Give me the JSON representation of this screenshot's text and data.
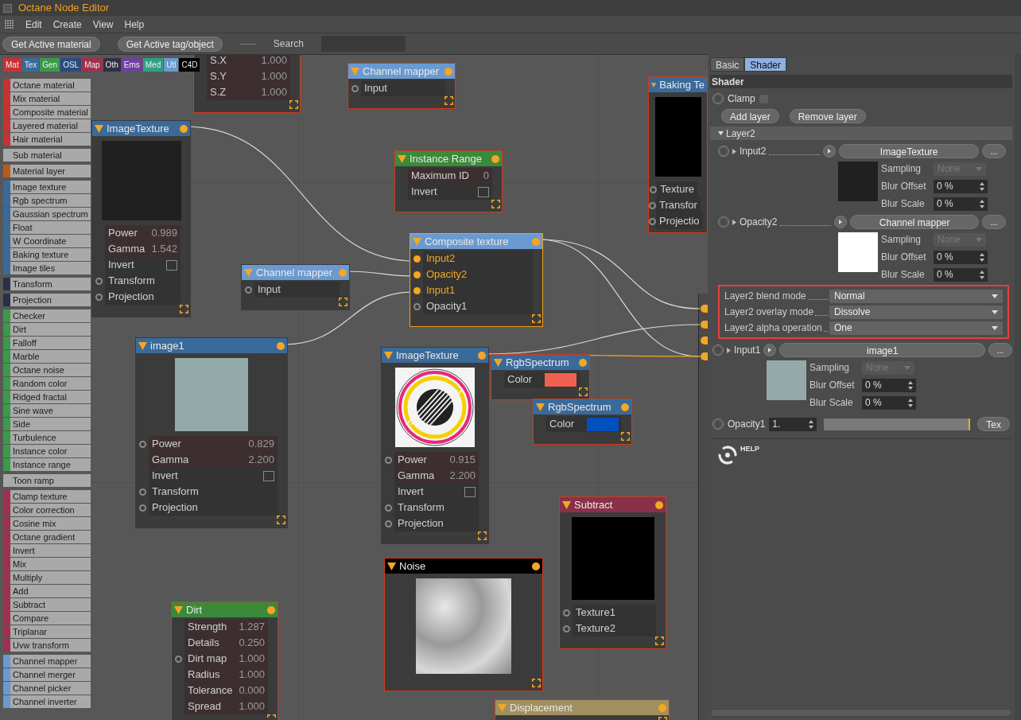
{
  "window": {
    "title": "Octane Node Editor"
  },
  "menu": [
    "Edit",
    "Create",
    "View",
    "Help"
  ],
  "toolbar": {
    "buttons": [
      "Get Active material",
      "Get Active tag/object"
    ],
    "search_label": "Search"
  },
  "palette": {
    "categories": [
      {
        "label": "Mat",
        "color": "#c83232"
      },
      {
        "label": "Tex",
        "color": "#3a6a9a"
      },
      {
        "label": "Gen",
        "color": "#3a9a4a"
      },
      {
        "label": "OSL",
        "color": "#2a4a80"
      },
      {
        "label": "Map",
        "color": "#a03050"
      },
      {
        "label": "Oth",
        "color": "#303040"
      },
      {
        "label": "Ems",
        "color": "#7040a0"
      },
      {
        "label": "Med",
        "color": "#30a080"
      },
      {
        "label": "Utl",
        "color": "#6a9ad0"
      },
      {
        "label": "C4D",
        "color": "#000000"
      }
    ],
    "groups": [
      {
        "color": "#c83232",
        "items": [
          "Octane material",
          "Mix material",
          "Composite material",
          "Layered material",
          "Hair material"
        ]
      },
      {
        "items": [
          "Sub material"
        ]
      },
      {
        "color": "#b85a20",
        "items": [
          "Material layer"
        ]
      },
      {
        "color": "#3a6a9a",
        "items": [
          "Image texture",
          "Rgb spectrum",
          "Gaussian spectrum",
          "Float",
          "W Coordinate",
          "Baking texture",
          "Image tiles"
        ]
      },
      {
        "color": "#2a3048",
        "items": [
          "Transform"
        ]
      },
      {
        "color": "#2a3048",
        "items": [
          "Projection"
        ]
      },
      {
        "color": "#3a9a4a",
        "items": [
          "Checker",
          "Dirt",
          "Falloff",
          "Marble",
          "Octane noise",
          "Random color",
          "Ridged fractal",
          "Sine wave",
          "Side",
          "Turbulence",
          "Instance color",
          "Instance range"
        ]
      },
      {
        "items": [
          "Toon ramp"
        ]
      },
      {
        "color": "#a03050",
        "items": [
          "Clamp texture",
          "Color correction",
          "Cosine mix",
          "Octane gradient",
          "Invert",
          "Mix",
          "Multiply",
          "Add",
          "Subtract",
          "Compare",
          "Triplanar",
          "Uvw transform"
        ]
      },
      {
        "color": "#6a9ad0",
        "items": [
          "Channel mapper",
          "Channel merger",
          "Channel picker",
          "Channel inverter"
        ]
      }
    ]
  },
  "nodes": [
    {
      "selected": true,
      "active": false,
      "rows": [
        {
          "kind": "value",
          "label": "S.X",
          "value": "1.000"
        },
        {
          "kind": "value",
          "label": "S.Y",
          "value": "1.000"
        },
        {
          "kind": "value",
          "label": "S.Z",
          "value": "1.000"
        }
      ]
    },
    {
      "title": "Channel mapper",
      "color": "#6a9ad0",
      "selected": true,
      "active": false,
      "rows": [
        {
          "kind": "port",
          "label": "Input",
          "connected": false
        }
      ]
    },
    {
      "title": "ImageTexture",
      "color": "#3a6a9a",
      "selected": false,
      "active": false,
      "preview": {
        "kind": "photo"
      },
      "rows": [
        {
          "kind": "value",
          "label": "Power",
          "value": "0.989"
        },
        {
          "kind": "value",
          "label": "Gamma",
          "value": "1.542"
        },
        {
          "kind": "check",
          "label": "Invert",
          "checked": false
        },
        {
          "kind": "port",
          "label": "Transform",
          "connected": false
        },
        {
          "kind": "port",
          "label": "Projection",
          "connected": false
        }
      ]
    },
    {
      "title": "Instance Range",
      "color": "#3a8a3a",
      "selected": true,
      "active": false,
      "rows": [
        {
          "kind": "value",
          "label": "Maximum ID",
          "value": "0"
        },
        {
          "kind": "check",
          "label": "Invert",
          "checked": false
        }
      ]
    },
    {
      "title": "Composite texture",
      "color": "#6a9ad0",
      "selected": false,
      "active": true,
      "rows": [
        {
          "kind": "port",
          "label": "Input2",
          "connected": true
        },
        {
          "kind": "port",
          "label": "Opacity2",
          "connected": true
        },
        {
          "kind": "port",
          "label": "Input1",
          "connected": true
        },
        {
          "kind": "port",
          "label": "Opacity1",
          "connected": false
        }
      ]
    },
    {
      "title": "Channel mapper",
      "color": "#6a9ad0",
      "selected": false,
      "active": false,
      "rows": [
        {
          "kind": "port",
          "label": "Input",
          "connected": false
        }
      ]
    },
    {
      "title": "image1",
      "color": "#3a6a9a",
      "selected": false,
      "active": false,
      "preview": {
        "kind": "pattern"
      },
      "rows": [
        {
          "kind": "port",
          "label": "Power",
          "value": "0.829",
          "connected": false
        },
        {
          "kind": "value",
          "label": "Gamma",
          "value": "2.200"
        },
        {
          "kind": "check",
          "label": "Invert",
          "checked": false
        },
        {
          "kind": "port",
          "label": "Transform",
          "connected": false
        },
        {
          "kind": "port",
          "label": "Projection",
          "connected": false
        }
      ]
    },
    {
      "title": "ImageTexture",
      "color": "#3a6a9a",
      "selected": false,
      "active": false,
      "preview": {
        "kind": "rings"
      },
      "rows": [
        {
          "kind": "port",
          "label": "Power",
          "value": "0.915",
          "connected": false
        },
        {
          "kind": "value",
          "label": "Gamma",
          "value": "2.200"
        },
        {
          "kind": "check",
          "label": "Invert",
          "checked": false
        },
        {
          "kind": "port",
          "label": "Transform",
          "connected": false
        },
        {
          "kind": "port",
          "label": "Projection",
          "connected": false
        }
      ]
    },
    {
      "title": "RgbSpectrum",
      "color": "#3a6a9a",
      "selected": true,
      "active": false,
      "rows": [
        {
          "kind": "color",
          "label": "Color",
          "color": "#f06050"
        }
      ]
    },
    {
      "title": "RgbSpectrum",
      "color": "#3a6a9a",
      "selected": true,
      "active": false,
      "rows": [
        {
          "kind": "color",
          "label": "Color",
          "color": "#0050c0"
        }
      ]
    },
    {
      "title": "Baking Te",
      "color": "#3a6a9a",
      "selected": true,
      "active": false,
      "preview": {
        "kind": "blank"
      },
      "rows": [
        {
          "kind": "port",
          "label": "Texture",
          "connected": false
        },
        {
          "kind": "port",
          "label": "Transfor",
          "connected": false
        },
        {
          "kind": "port",
          "label": "Projectio",
          "connected": false
        }
      ]
    },
    {
      "title": "Noise",
      "color": "#000000",
      "selected": true,
      "active": false,
      "preview": {
        "kind": "noise"
      }
    },
    {
      "title": "Subtract",
      "color": "#8a3048",
      "selected": true,
      "active": false,
      "preview": {
        "kind": "blank"
      },
      "rows": [
        {
          "kind": "port",
          "label": "Texture1",
          "connected": false
        },
        {
          "kind": "port",
          "label": "Texture2",
          "connected": false
        }
      ]
    },
    {
      "title": "Dirt",
      "color": "#3a8a3a",
      "selected": true,
      "active": false,
      "rows": [
        {
          "kind": "value",
          "label": "Strength",
          "value": "1.287"
        },
        {
          "kind": "value",
          "label": "Details",
          "value": "0.250"
        },
        {
          "kind": "port",
          "label": "Dirt map",
          "value": "1.000",
          "connected": false
        },
        {
          "kind": "value",
          "label": "Radius",
          "value": "1.000"
        },
        {
          "kind": "value",
          "label": "Tolerance",
          "value": "0.000"
        },
        {
          "kind": "value",
          "label": "Spread",
          "value": "1.000"
        }
      ]
    },
    {
      "title": "Displacement",
      "color": "#a09060",
      "selected": true,
      "active": false
    }
  ],
  "inspector": {
    "tabs": [
      {
        "label": "Basic",
        "selected": false
      },
      {
        "label": "Shader",
        "selected": true
      }
    ],
    "section": "Shader",
    "clamp": {
      "label": "Clamp",
      "checked": false
    },
    "buttons": [
      "Add layer",
      "Remove layer"
    ],
    "layer": {
      "label": "Layer2",
      "expanded": true,
      "inputs": [
        {
          "label": "Input2",
          "target": "ImageTexture",
          "more": "...",
          "preview": {
            "kind": "photo"
          },
          "params": [
            {
              "kind": "dropdown",
              "label": "Sampling",
              "value": "None",
              "disabled": true
            },
            {
              "kind": "spinner",
              "label": "Blur Offset",
              "value": "0 %"
            },
            {
              "kind": "spinner",
              "label": "Blur Scale",
              "value": "0 %"
            }
          ]
        },
        {
          "label": "Opacity2",
          "target": "Channel mapper",
          "more": "...",
          "preview": {
            "kind": "mask"
          },
          "params": [
            {
              "kind": "dropdown",
              "label": "Sampling",
              "value": "None",
              "disabled": true
            },
            {
              "kind": "spinner",
              "label": "Blur Offset",
              "value": "0 %"
            },
            {
              "kind": "spinner",
              "label": "Blur Scale",
              "value": "0 %"
            }
          ]
        }
      ],
      "modes": [
        {
          "label": "Layer2 blend mode",
          "value": "Normal"
        },
        {
          "label": "Layer2 overlay mode",
          "value": "Dissolve"
        },
        {
          "label": "Layer2 alpha operation",
          "value": "One"
        }
      ]
    },
    "input1": {
      "label": "Input1",
      "target": "image1",
      "more": "...",
      "preview": {
        "kind": "pattern"
      },
      "params": [
        {
          "kind": "dropdown",
          "label": "Sampling",
          "value": "None",
          "disabled": true
        },
        {
          "kind": "spinner",
          "label": "Blur Offset",
          "value": "0 %"
        },
        {
          "kind": "spinner",
          "label": "Blur Scale",
          "value": "0 %"
        }
      ]
    },
    "opacity": {
      "label": "Opacity1",
      "value": "1.",
      "level": 1.0,
      "button": "Tex"
    },
    "help_label": "HELP"
  }
}
